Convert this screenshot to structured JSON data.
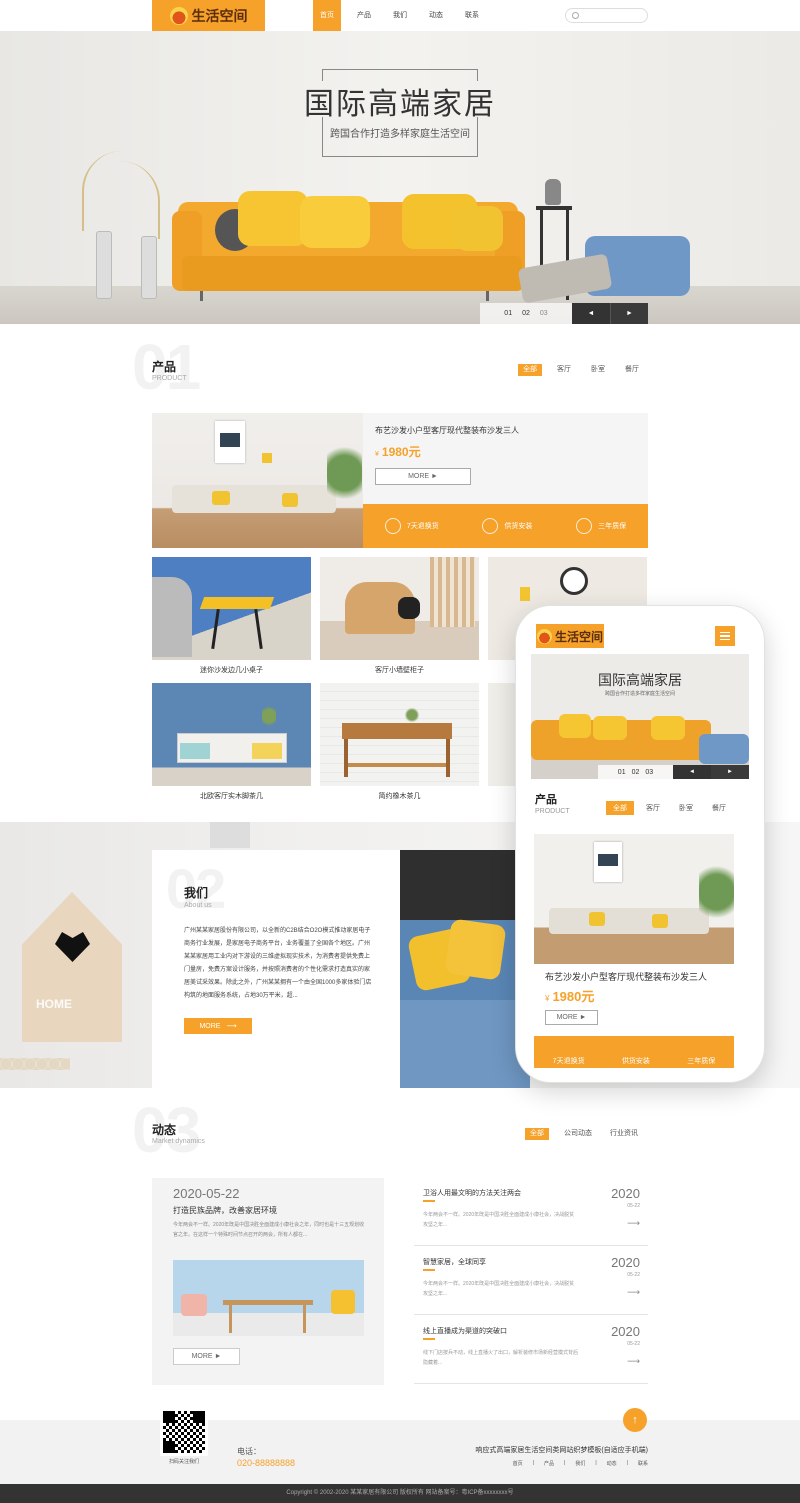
{
  "header": {
    "logo_text": "生活空间",
    "nav": [
      "首页",
      "产品",
      "我们",
      "动态",
      "联系"
    ]
  },
  "banner": {
    "title": "国际高端家居",
    "subtitle": "跨国合作打造多样家庭生活空间",
    "slides": [
      "01",
      "02",
      "03"
    ],
    "prev": "◄",
    "next": "►"
  },
  "products": {
    "num": "01",
    "title": "产品",
    "subtitle": "PRODUCT",
    "tabs": [
      "全部",
      "客厅",
      "卧室",
      "餐厅"
    ],
    "featured": {
      "title": "布艺沙发小户型客厅现代整装布沙发三人",
      "currency": "¥",
      "price": "1980元",
      "more": "MORE ►",
      "features": [
        "7天退换货",
        "供货安装",
        "三年质保"
      ]
    },
    "items": [
      {
        "caption": "迷你沙发边几小桌子"
      },
      {
        "caption": "客厅小墙壁柜子"
      },
      {
        "caption": ""
      },
      {
        "caption": "北欧客厅实木脚茶几"
      },
      {
        "caption": "简约橡木茶几"
      },
      {
        "caption": ""
      }
    ]
  },
  "about": {
    "num": "02",
    "title": "我们",
    "subtitle": "About us",
    "text": "广州某某家居股份有限公司，以全新的C2B结合O2O模式推动家居电子商务行业发展，是家居电子商务平台，业务覆盖了全国各个地区。广州某某家居用工业内对下游设的三维虚拟现实技术，为消费者提供免费上门量房，免费方案设计服务，并按照消费者的个性化需求打造真实的家居美试采效果。除此之外，广州某某拥有一个由全国1000多家体验门店构筑的地面服务系统，占地30万平米，超...",
    "more": "MORE"
  },
  "news": {
    "num": "03",
    "title": "动态",
    "subtitle": "Market dynamics",
    "tabs": [
      "全部",
      "公司动态",
      "行业资讯"
    ],
    "featured": {
      "date": "2020-05-22",
      "title": "打造民族品牌，改善家居环境",
      "text": "今年两会不一样。2020年既是中国决胜全面建成小康社会之年，同时也是十三五规划收官之年。在这样一个特殊时间节点召开的两会，所有人都在...",
      "more": "MORE ►"
    },
    "list": [
      {
        "title": "卫浴人用最文明的方法关注两会",
        "desc": "今年两会不一样。2020年既是中国决胜全面建成小康社会，决战脱贫攻坚之年...",
        "year": "2020",
        "md": "05-22",
        "arrow": "⟶"
      },
      {
        "title": "智慧家居，全球同享",
        "desc": "今年两会不一样。2020年既是中国决胜全面建成小康社会，决战脱贫攻坚之年...",
        "year": "2020",
        "md": "05-22",
        "arrow": "⟶"
      },
      {
        "title": "线上直播成为渠道的突破口",
        "desc": "线下门店按兵不动，线上直播火了出口，解析装修市场新经营模式背后隐藏着...",
        "year": "2020",
        "md": "05-22",
        "arrow": "⟶"
      }
    ]
  },
  "footer": {
    "qr_label": "扫码关注我们",
    "phone_label": "电话：",
    "phone": "020-88888888",
    "site_desc": "响应式高端家居生活空间类网站织梦模板(自适应手机端)",
    "links": [
      "首页",
      "产品",
      "我们",
      "动态",
      "联系"
    ],
    "top_arrow": "↑",
    "copyright": "Copyright © 2002-2020 某某家居有限公司 版权所有 网站备案号：粤ICP备xxxxxxxx号"
  },
  "phone": {
    "logo_text": "生活空间",
    "banner_title": "国际高端家居",
    "banner_sub": "跨国合作打造多样家庭生活空间",
    "slides": [
      "01",
      "02",
      "03"
    ],
    "prev": "◄",
    "next": "►",
    "section_title": "产品",
    "section_sub": "PRODUCT",
    "tabs": [
      "全部",
      "客厅",
      "卧室",
      "餐厅"
    ],
    "product_title": "布艺沙发小户型客厅现代整装布沙发三人",
    "currency": "¥",
    "price": "1980元",
    "more": "MORE ►",
    "features": [
      "7天退换货",
      "供货安装",
      "三年质保"
    ]
  }
}
